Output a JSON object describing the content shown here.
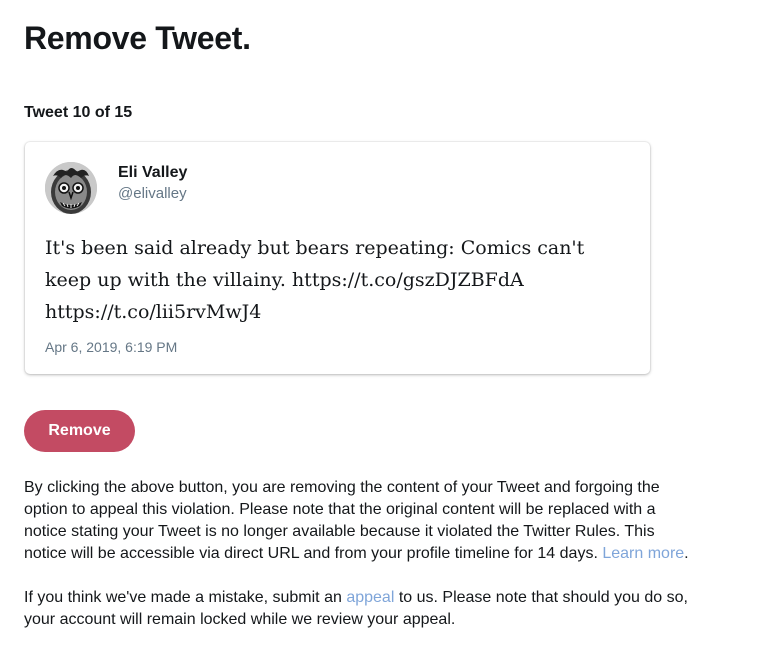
{
  "page": {
    "title": "Remove Tweet.",
    "counter": "Tweet 10 of 15"
  },
  "tweet": {
    "author_name": "Eli Valley",
    "author_handle": "@elivalley",
    "avatar_icon": "user-avatar-icon",
    "text_line1": "It's been said already but bears repeating: Comics can't",
    "text_line2": "keep up with the villainy. https://t.co/gszDJZBFdA",
    "text_line3": "https://t.co/lii5rvMwJ4",
    "timestamp": "Apr 6, 2019, 6:19 PM"
  },
  "actions": {
    "remove_label": "Remove",
    "remove_color": "#c34b63"
  },
  "notice": {
    "p1_line1": "By clicking the above button, you are removing the content of your Tweet and forgoing the",
    "p1_line2": "option to appeal this violation. Please note that the original content will be replaced with a",
    "p1_line3": "notice stating your Tweet is no longer available because it violated the Twitter Rules. This",
    "p1_line4": "notice will be accessible via direct URL and from your profile timeline for 14 days.",
    "learn_more": "Learn more",
    "after_learn_more": ".",
    "p2_before": "If you think we've made a mistake, submit an",
    "appeal_link": "appeal",
    "p2_after_line1": "to us. Please note that should you do so,",
    "p2_line2": "your account will remain locked while we review your appeal.",
    "link_color": "#7fa5d9"
  }
}
